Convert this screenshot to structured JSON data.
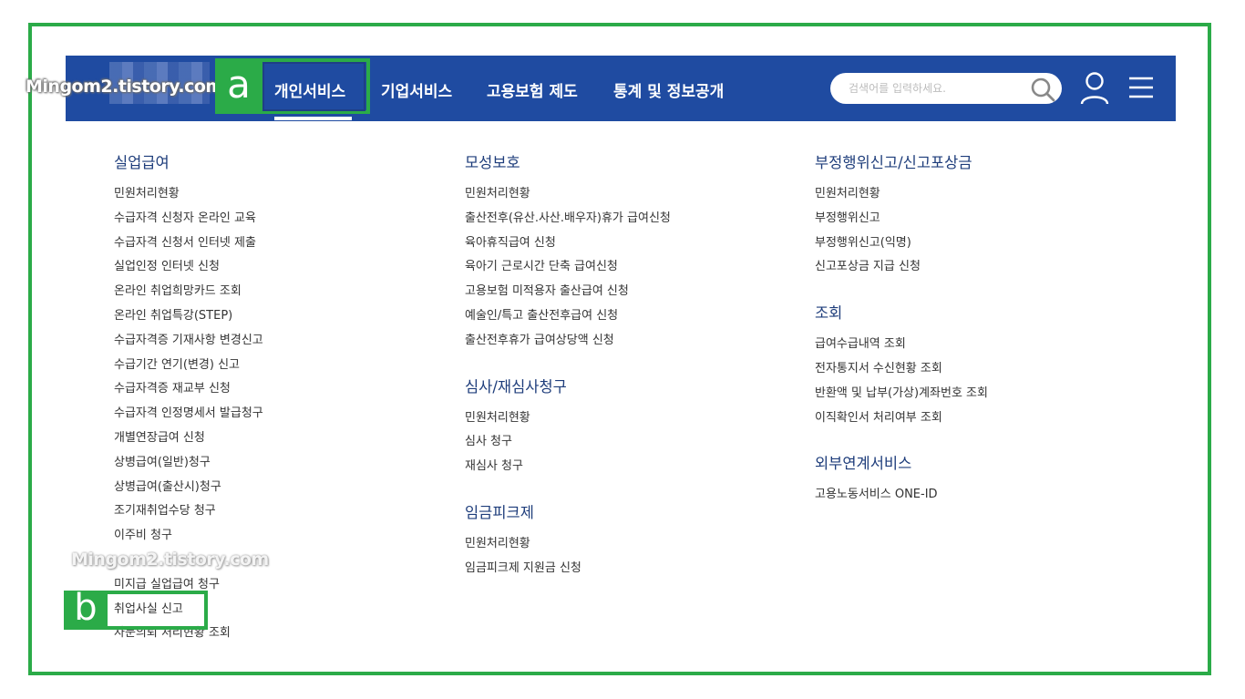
{
  "watermark": "Mingom2.tistory.com",
  "annotations": {
    "a": "a",
    "b": "b"
  },
  "nav": {
    "items": [
      "개인서비스",
      "기업서비스",
      "고용보험 제도",
      "통계 및 정보공개"
    ],
    "active": "개인서비스"
  },
  "search": {
    "placeholder": "검색어를 입력하세요."
  },
  "icons": {
    "search": "search-icon",
    "user": "user-icon",
    "menu": "menu-icon"
  },
  "colors": {
    "navbar": "#1f4ba1",
    "annotation": "#2bab48",
    "section_title": "#1e3d7b"
  },
  "columns": [
    {
      "sections": [
        {
          "title": "실업급여",
          "items": [
            "민원처리현황",
            "수급자격 신청자 온라인 교육",
            "수급자격 신청서 인터넷 제출",
            "실업인정 인터넷 신청",
            "온라인 취업희망카드 조회",
            "온라인 취업특강(STEP)",
            "수급자격증 기재사항 변경신고",
            "수급기간 연기(변경) 신고",
            "수급자격증 재교부 신청",
            "수급자격 인정명세서 발급청구",
            "개별연장급여 신청",
            "상병급여(일반)청구",
            "상병급여(출산시)청구",
            "조기재취업수당 청구",
            "이주비 청구",
            "",
            "미지급 실업급여 청구",
            "취업사실 신고",
            "자문의뢰 처리현황 조회"
          ]
        }
      ]
    },
    {
      "sections": [
        {
          "title": "모성보호",
          "items": [
            "민원처리현황",
            "출산전후(유산.사산.배우자)휴가 급여신청",
            "육아휴직급여 신청",
            "육아기 근로시간 단축 급여신청",
            "고용보험 미적용자 출산급여 신청",
            "예술인/특고 출산전후급여 신청",
            "출산전후휴가 급여상당액 신청"
          ]
        },
        {
          "title": "심사/재심사청구",
          "items": [
            "민원처리현황",
            "심사 청구",
            "재심사 청구"
          ]
        },
        {
          "title": "임금피크제",
          "items": [
            "민원처리현황",
            "임금피크제 지원금 신청"
          ]
        }
      ]
    },
    {
      "sections": [
        {
          "title": "부정행위신고/신고포상금",
          "items": [
            "민원처리현황",
            "부정행위신고",
            "부정행위신고(익명)",
            "신고포상금 지급 신청"
          ]
        },
        {
          "title": "조회",
          "items": [
            "급여수급내역 조회",
            "전자통지서 수신현황 조회",
            "반환액 및 납부(가상)계좌번호 조회",
            "이직확인서 처리여부 조회"
          ]
        },
        {
          "title": "외부연계서비스",
          "items": [
            "고용노동서비스 ONE-ID"
          ]
        }
      ]
    }
  ]
}
